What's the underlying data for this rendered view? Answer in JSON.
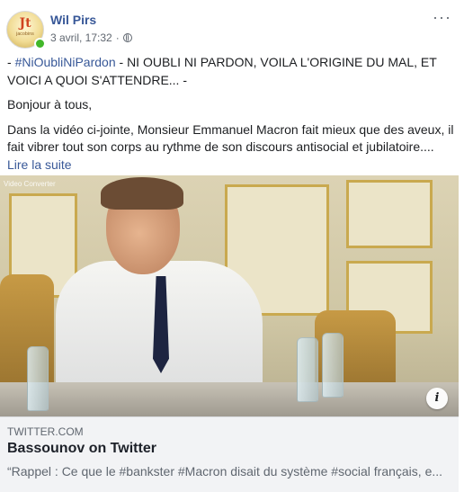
{
  "post": {
    "author": "Wil Pirs",
    "date": "3 avril, 17:32",
    "separator": "·",
    "more_icon": "···",
    "avatar": {
      "mark": "Jt",
      "caption": "jacobins"
    },
    "body": {
      "hashtag": "#NiOubliNiPardon",
      "line1_prefix": "- ",
      "line1_rest": " - NI OUBLI NI PARDON, VOILA L'ORIGINE DU MAL, ET VOICI A QUOI S'ATTENDRE... -",
      "greeting": "Bonjour à tous,",
      "paragraph": "Dans la vidéo ci-jointe, Monsieur Emmanuel Macron fait mieux que des aveux, il fait vibrer tout son corps au rythme de son discours antisocial et jubilatoire....",
      "read_more": "Lire la suite"
    }
  },
  "media": {
    "watermark": "Video Converter",
    "info_icon": "i"
  },
  "link_preview": {
    "domain": "TWITTER.COM",
    "title": "Bassounov on Twitter",
    "description": "“Rappel : Ce que le #bankster #Macron disait du système #social français, e..."
  },
  "icons": {
    "avatar": "profile-avatar-icon",
    "online": "online-status-icon",
    "audience": "globe-icon",
    "more": "more-options-icon",
    "info": "info-icon"
  },
  "colors": {
    "link_blue": "#385898",
    "meta_gray": "#606770",
    "online_green": "#42b72a",
    "card_bg": "#f2f3f5"
  }
}
